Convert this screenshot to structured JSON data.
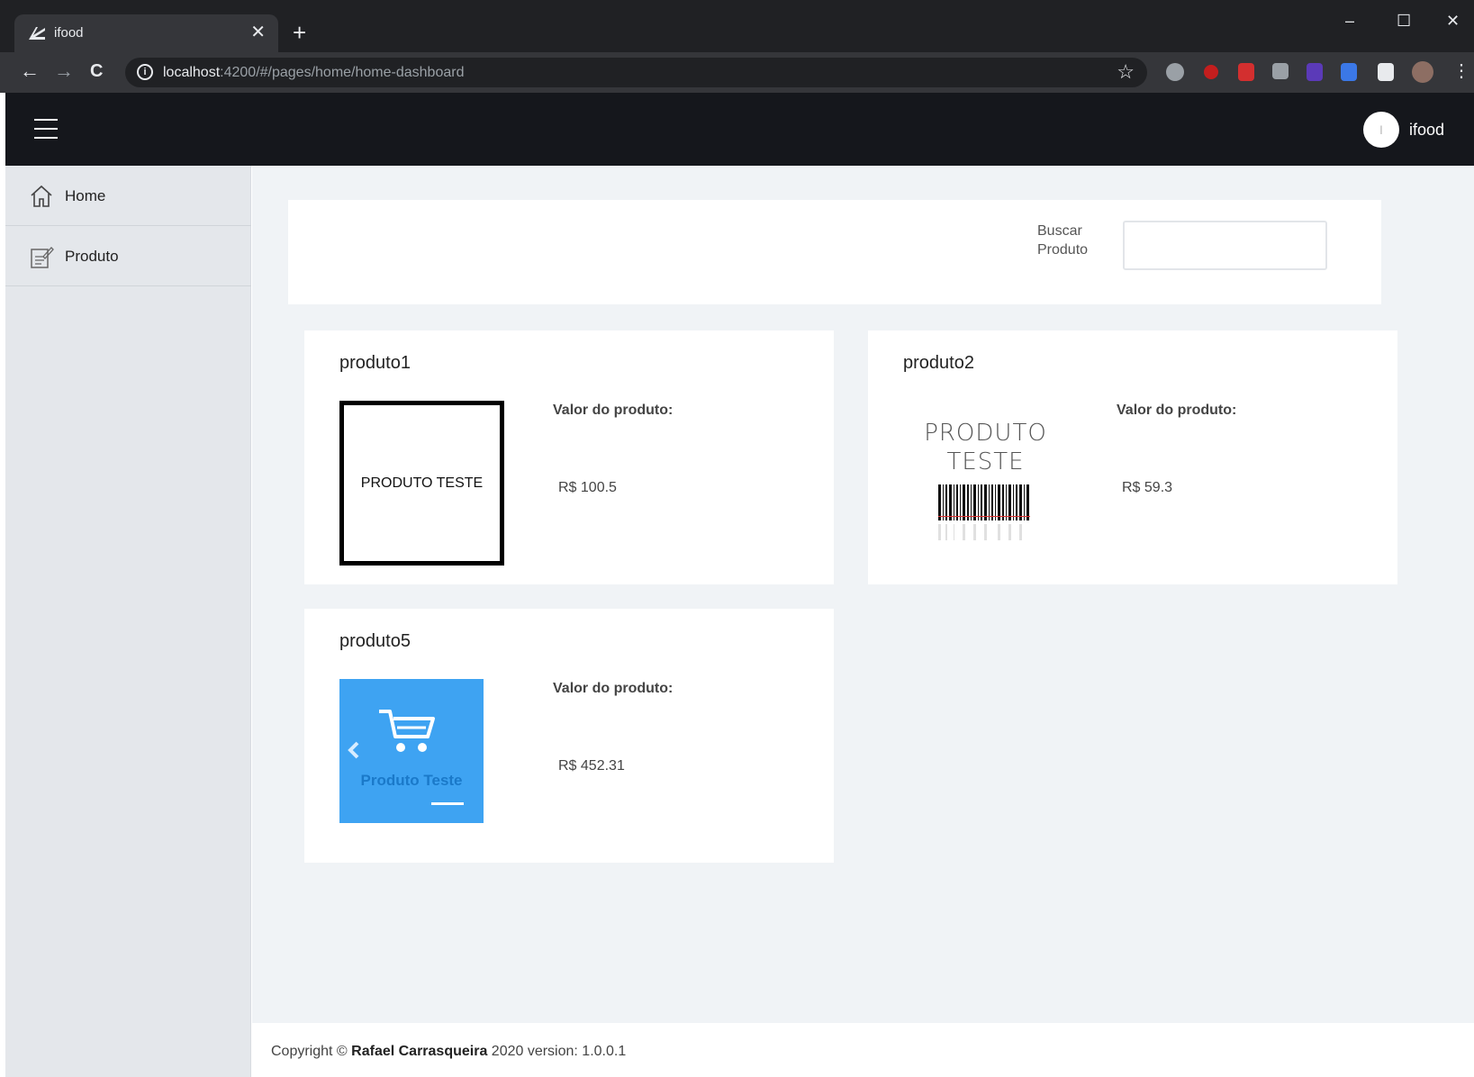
{
  "browser": {
    "tab_title": "ifood",
    "tab_close": "✕",
    "new_tab": "+",
    "url_host": "localhost",
    "url_rest": ":4200/#/pages/home/home-dashboard",
    "window_controls": [
      "–",
      "☐",
      "✕"
    ]
  },
  "header": {
    "user_initial": "I",
    "user_name": "ifood"
  },
  "sidebar": {
    "items": [
      {
        "label": "Home",
        "icon": "home-icon"
      },
      {
        "label": "Produto",
        "icon": "edit-icon"
      }
    ]
  },
  "search": {
    "label": "Buscar Produto",
    "value": ""
  },
  "products": [
    {
      "name": "produto1",
      "price_label": "Valor do produto:",
      "price": "R$ 100.5",
      "image_text": "PRODUTO TESTE"
    },
    {
      "name": "produto2",
      "price_label": "Valor do produto:",
      "price": "R$ 59.3",
      "image_text": "PRODUTO TESTE"
    },
    {
      "name": "produto5",
      "price_label": "Valor do produto:",
      "price": "R$ 452.31",
      "image_text": "Produto Teste"
    }
  ],
  "footer": {
    "prefix": "Copyright © ",
    "author": "Rafael Carrasqueira",
    "suffix": " 2020 version: 1.0.0.1"
  },
  "colors": {
    "header_bg": "#15171c",
    "sidebar_bg": "#e4e7eb",
    "main_bg": "#f0f3f6",
    "product5_image_bg": "#3ea3f2"
  }
}
